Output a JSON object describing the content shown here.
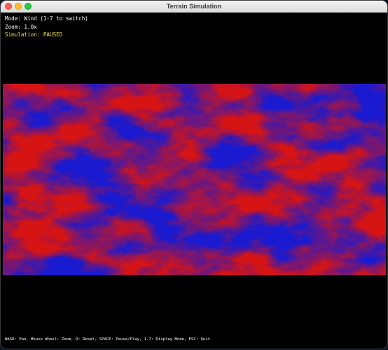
{
  "window": {
    "title": "Terrain Simulation"
  },
  "hud": {
    "mode": "Mode: Wind (1-7 to switch)",
    "zoom": "Zoom: 1.0x",
    "status": "Simulation: PAUSED"
  },
  "footer": {
    "help": "WASD: Pan, Mouse Wheel: Zoom, R: Reset, SPACE: Pause/Play, 1-7: Display Mode, ESC: Quit"
  },
  "colors": {
    "wind_low": "#1a1ad0",
    "wind_high": "#d61414",
    "status_text": "#f1e15b"
  }
}
